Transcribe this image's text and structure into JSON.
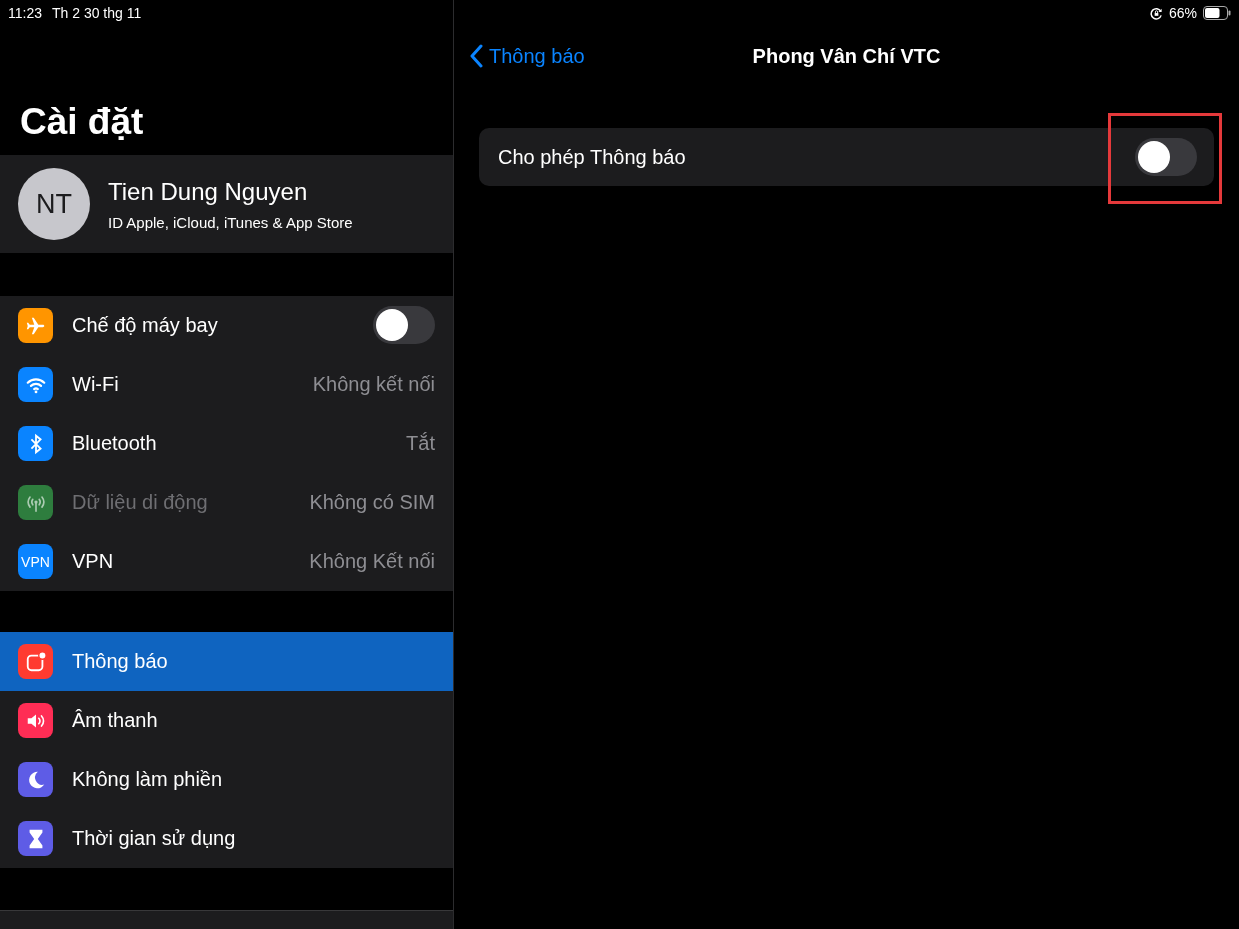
{
  "status_bar": {
    "time": "11:23",
    "date": "Th 2 30 thg 11",
    "battery": "66%"
  },
  "sidebar": {
    "title": "Cài đặt",
    "profile": {
      "initials": "NT",
      "name": "Tien Dung Nguyen",
      "subtitle": "ID Apple, iCloud, iTunes & App Store"
    },
    "groups": [
      {
        "items": [
          {
            "kind": "toggle",
            "label": "Chế độ máy bay",
            "on": false,
            "disabled": false,
            "selected": false,
            "color": "#ff9500"
          },
          {
            "kind": "value",
            "label": "Wi-Fi",
            "value": "Không kết nối",
            "disabled": false,
            "selected": false,
            "color": "#0a84ff"
          },
          {
            "kind": "value",
            "label": "Bluetooth",
            "value": "Tắt",
            "disabled": false,
            "selected": false,
            "color": "#0a84ff"
          },
          {
            "kind": "value",
            "label": "Dữ liệu di động",
            "value": "Không có SIM",
            "disabled": true,
            "selected": false,
            "color": "#2e7d3e"
          },
          {
            "kind": "value",
            "label": "VPN",
            "badge": "VPN",
            "value": "Không Kết nối",
            "disabled": false,
            "selected": false,
            "color": "#0a84ff"
          }
        ]
      },
      {
        "items": [
          {
            "kind": "link",
            "label": "Thông báo",
            "disabled": false,
            "selected": true,
            "color": "#ff3b30"
          },
          {
            "kind": "link",
            "label": "Âm thanh",
            "disabled": false,
            "selected": false,
            "color": "#ff2d55"
          },
          {
            "kind": "link",
            "label": "Không làm phiền",
            "disabled": false,
            "selected": false,
            "color": "#5e5ce6"
          },
          {
            "kind": "link",
            "label": "Thời gian sử dụng",
            "disabled": false,
            "selected": false,
            "color": "#5e5ce6"
          }
        ]
      }
    ]
  },
  "detail": {
    "back": "Thông báo",
    "title": "Phong Vân Chí VTC",
    "settings": [
      {
        "label": "Cho phép Thông báo",
        "on": false,
        "highlighted": true
      }
    ]
  }
}
